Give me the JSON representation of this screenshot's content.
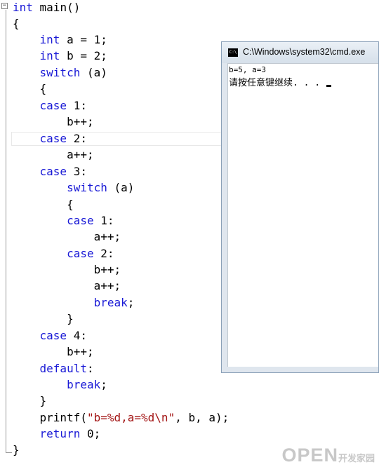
{
  "code": [
    [
      {
        "t": "int",
        "c": "kw"
      },
      {
        "t": " main()"
      }
    ],
    [
      {
        "t": "{"
      }
    ],
    [
      {
        "t": "    "
      },
      {
        "t": "int",
        "c": "kw"
      },
      {
        "t": " a = 1;"
      }
    ],
    [
      {
        "t": "    "
      },
      {
        "t": "int",
        "c": "kw"
      },
      {
        "t": " b = 2;"
      }
    ],
    [
      {
        "t": "    "
      },
      {
        "t": "switch",
        "c": "kw"
      },
      {
        "t": " (a)"
      }
    ],
    [
      {
        "t": "    {"
      }
    ],
    [
      {
        "t": "    "
      },
      {
        "t": "case",
        "c": "kw"
      },
      {
        "t": " 1:"
      }
    ],
    [
      {
        "t": "        b++;"
      }
    ],
    [
      {
        "t": "    "
      },
      {
        "t": "case",
        "c": "kw"
      },
      {
        "t": " 2:"
      }
    ],
    [
      {
        "t": "        a++;"
      }
    ],
    [
      {
        "t": "    "
      },
      {
        "t": "case",
        "c": "kw"
      },
      {
        "t": " 3:"
      }
    ],
    [
      {
        "t": "        "
      },
      {
        "t": "switch",
        "c": "kw"
      },
      {
        "t": " (a)"
      }
    ],
    [
      {
        "t": "        {"
      }
    ],
    [
      {
        "t": "        "
      },
      {
        "t": "case",
        "c": "kw"
      },
      {
        "t": " 1:"
      }
    ],
    [
      {
        "t": "            a++;"
      }
    ],
    [
      {
        "t": "        "
      },
      {
        "t": "case",
        "c": "kw"
      },
      {
        "t": " 2:"
      }
    ],
    [
      {
        "t": "            b++;"
      }
    ],
    [
      {
        "t": "            a++;"
      }
    ],
    [
      {
        "t": "            "
      },
      {
        "t": "break",
        "c": "kw"
      },
      {
        "t": ";"
      }
    ],
    [
      {
        "t": "        }"
      }
    ],
    [
      {
        "t": "    "
      },
      {
        "t": "case",
        "c": "kw"
      },
      {
        "t": " 4:"
      }
    ],
    [
      {
        "t": "        b++;"
      }
    ],
    [
      {
        "t": "    "
      },
      {
        "t": "default",
        "c": "kw"
      },
      {
        "t": ":"
      }
    ],
    [
      {
        "t": "        "
      },
      {
        "t": "break",
        "c": "kw"
      },
      {
        "t": ";"
      }
    ],
    [
      {
        "t": "    }"
      }
    ],
    [
      {
        "t": "    printf("
      },
      {
        "t": "\"b=%d,a=%d\\n\"",
        "c": "str"
      },
      {
        "t": ", b, a);"
      }
    ],
    [
      {
        "t": "    "
      },
      {
        "t": "return",
        "c": "kw"
      },
      {
        "t": " 0;"
      }
    ],
    [
      {
        "t": "}"
      }
    ]
  ],
  "fold_marker": "−",
  "cmd": {
    "icon_text": "C:\\",
    "title": "C:\\Windows\\system32\\cmd.exe",
    "output": [
      "b=5, a=3",
      "请按任意键继续. . ."
    ]
  },
  "watermark": {
    "big": "OPEN",
    "small": "开发家园"
  },
  "colors": {
    "keyword": "#1a1ad6",
    "string": "#a31515",
    "cmd_frame": "#dfe6ee"
  }
}
